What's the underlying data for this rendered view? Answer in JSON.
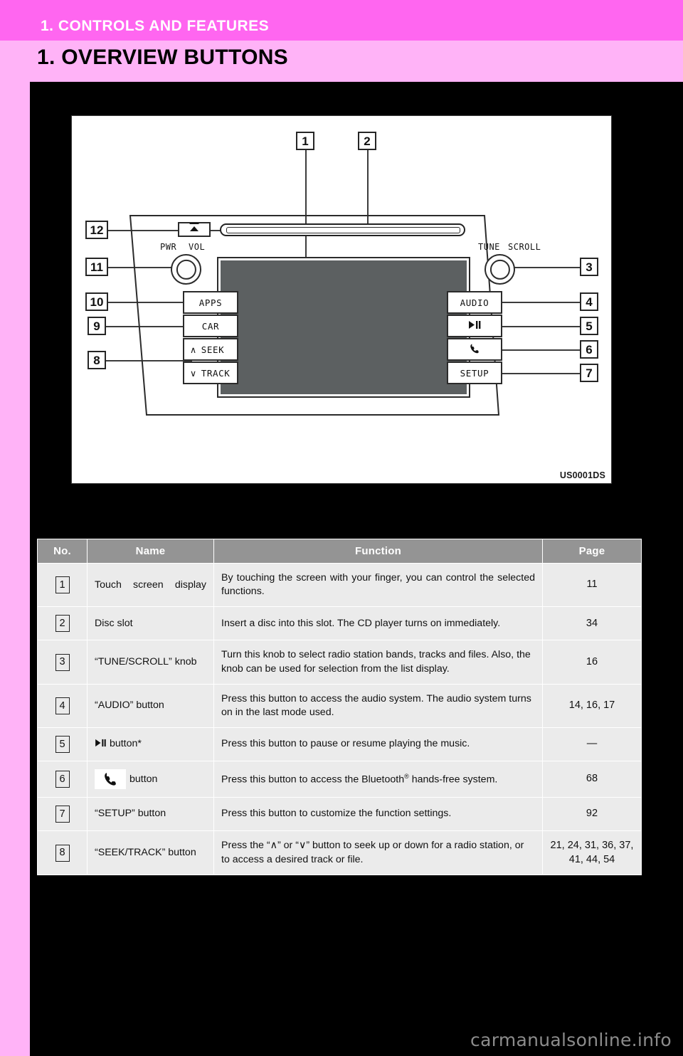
{
  "header": {
    "chapter": "1. CONTROLS AND FEATURES",
    "section_title": "1. OVERVIEW BUTTONS"
  },
  "figure": {
    "code": "US0001DS",
    "callouts": [
      "1",
      "2",
      "3",
      "4",
      "5",
      "6",
      "7",
      "8",
      "9",
      "10",
      "11",
      "12"
    ],
    "unit_labels": {
      "pwr": "PWR",
      "vol": "VOL",
      "tune": "TUNE",
      "scroll": "SCROLL",
      "apps": "APPS",
      "car": "CAR",
      "seek": "SEEK",
      "track": "TRACK",
      "seek_arrow": "∧",
      "track_arrow": "∨",
      "audio": "AUDIO",
      "play_pause": "▶❙❙",
      "phone": "phone-icon",
      "setup": "SETUP",
      "eject": "eject-icon"
    }
  },
  "table": {
    "columns": [
      "No.",
      "Name",
      "Function",
      "Page"
    ],
    "rows": [
      {
        "no": "1",
        "name": "Touch screen display",
        "function": "By touching the screen with your finger, you can control the selected functions.",
        "page": "11"
      },
      {
        "no": "2",
        "name": "Disc slot",
        "function": "Insert a disc into this slot. The CD player turns on immediately.",
        "page": "34"
      },
      {
        "no": "3",
        "name": "“TUNE/SCROLL” knob",
        "function": "Turn this knob to select radio station bands, tracks and files. Also, the knob can be used for selection from the list display.",
        "page": "16"
      },
      {
        "no": "4",
        "name": "“AUDIO” button",
        "function": "Press this button to access the audio system. The audio system turns on in the last mode used.",
        "page": "14, 16, 17"
      },
      {
        "no": "5",
        "name": "▶❙❙ button*",
        "function": "Press this button to pause or resume playing the music.",
        "page": "—"
      },
      {
        "no": "6",
        "name": "button",
        "name_icon": "phone-icon",
        "function_pre": "Press this button to access the Bluetooth",
        "function_sup": "®",
        "function_post": " hands-free system.",
        "page": "68"
      },
      {
        "no": "7",
        "name": "“SETUP” button",
        "function": "Press this button to customize the function settings.",
        "page": "92"
      },
      {
        "no": "8",
        "name": "“SEEK/TRACK” button",
        "function_pre": "Press the “",
        "function_arrow_up": "∧",
        "function_mid": "” or “",
        "function_arrow_dn": "∨",
        "function_post": "” button to seek up or down for a radio station, or to access a desired track or file.",
        "page": "21, 24, 31, 36, 37, 41, 44, 54"
      }
    ]
  },
  "watermark": "carmanualsonline.info",
  "colors": {
    "chapter_bar": "#ff66f0",
    "section_band": "#ffb3f7",
    "page_body": "#000000",
    "table_header": "#949494",
    "table_cell": "#ebebeb"
  }
}
